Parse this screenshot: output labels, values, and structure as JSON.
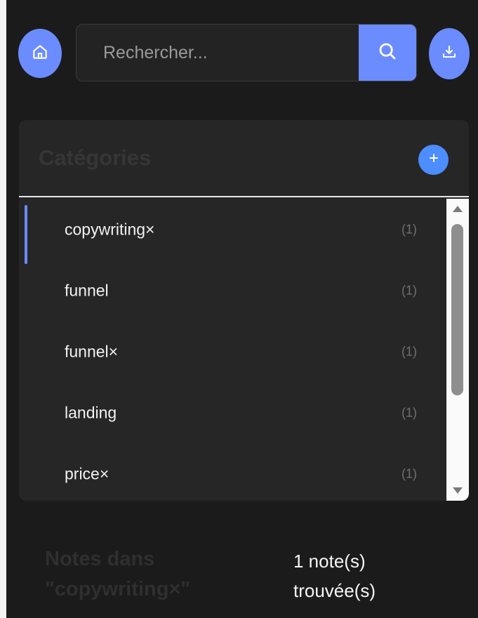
{
  "toolbar": {
    "home_icon": "home-icon",
    "search_placeholder": "Rechercher...",
    "search_value": "",
    "search_icon": "search-icon",
    "download_icon": "download-icon",
    "accent_color": "#6b8cff"
  },
  "categories": {
    "title": "Catégories",
    "add_icon": "plus-icon",
    "items": [
      {
        "label": "copywriting×",
        "count": "(1)",
        "active": true
      },
      {
        "label": "funnel",
        "count": "(1)",
        "active": false
      },
      {
        "label": "funnel×",
        "count": "(1)",
        "active": false
      },
      {
        "label": "landing",
        "count": "(1)",
        "active": false
      },
      {
        "label": "price×",
        "count": "(1)",
        "active": false
      }
    ]
  },
  "notes": {
    "title_line1": "Notes dans",
    "title_line2": "\"copywriting×\"",
    "count_line1": "1 note(s)",
    "count_line2": "trouvée(s)"
  }
}
